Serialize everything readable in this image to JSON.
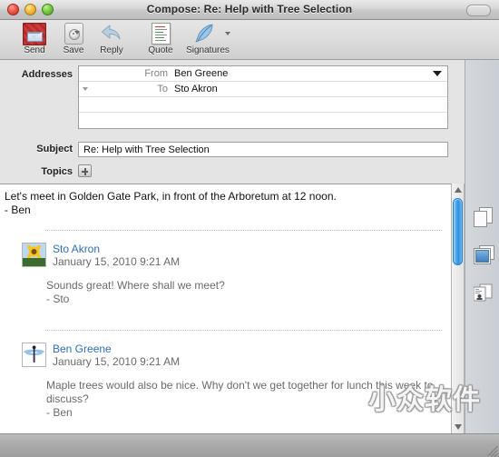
{
  "window": {
    "title": "Compose: Re: Help with Tree Selection",
    "close_label": "Close",
    "minimize_label": "Minimize",
    "zoom_label": "Zoom",
    "toolbar_toggle_label": "Toggle Toolbar"
  },
  "toolbar": {
    "items": [
      {
        "label": "Send",
        "icon": "stamp-envelope-icon",
        "has_menu": false
      },
      {
        "label": "Save",
        "icon": "disk-drive-icon",
        "has_menu": true
      },
      {
        "label": "Reply",
        "icon": "reply-arrow-icon",
        "has_menu": false
      },
      {
        "label": "Quote",
        "icon": "quote-document-icon",
        "has_menu": false
      },
      {
        "label": "Signatures",
        "icon": "feather-quill-icon",
        "has_menu": true
      }
    ]
  },
  "form": {
    "addresses_label": "Addresses",
    "subject_label": "Subject",
    "topics_label": "Topics",
    "topics_add_label": "+",
    "address_rows": [
      {
        "key": "From",
        "value": "Ben Greene",
        "has_disclosure": false
      },
      {
        "key": "To",
        "value": "Sto Akron",
        "has_disclosure": true
      },
      {
        "key": "",
        "value": "",
        "has_disclosure": false
      },
      {
        "key": "",
        "value": "",
        "has_disclosure": false
      }
    ],
    "subject_value": "Re: Help with Tree Selection",
    "subject_placeholder": "Subject"
  },
  "body": {
    "compose_line1": "Let's meet in Golden Gate Park, in front of the Arboretum at 12 noon.",
    "compose_line2": "- Ben",
    "quotes": [
      {
        "avatar": "sunflower-avatar",
        "name": "Sto Akron",
        "date": "January 15, 2010 9:21 AM",
        "line1": "Sounds great!  Where shall we meet?",
        "line2": "- Sto"
      },
      {
        "avatar": "dragonfly-avatar",
        "name": "Ben Greene",
        "date": "January 15, 2010 9:21 AM",
        "line1": "Maple trees would also be nice.  Why don't we get together for lunch this week to",
        "line2": "discuss?",
        "line3": "- Ben"
      }
    ]
  },
  "side_panel": {
    "items": [
      {
        "icon": "documents-icon",
        "label": "Documents"
      },
      {
        "icon": "images-icon",
        "label": "Images"
      },
      {
        "icon": "clippings-icon",
        "label": "Clippings"
      }
    ]
  },
  "scrollbar": {
    "up_label": "Scroll up",
    "down_label": "Scroll down",
    "thumb_label": "Scroll thumb"
  },
  "watermark": {
    "text": "小众软件"
  },
  "colors": {
    "link": "#2f6fb3",
    "quote_text": "#6a6a6a",
    "scrollbar_thumb": "#2f8fe0",
    "send_icon": "#c43030",
    "titlebar": "#d6d6d6"
  }
}
